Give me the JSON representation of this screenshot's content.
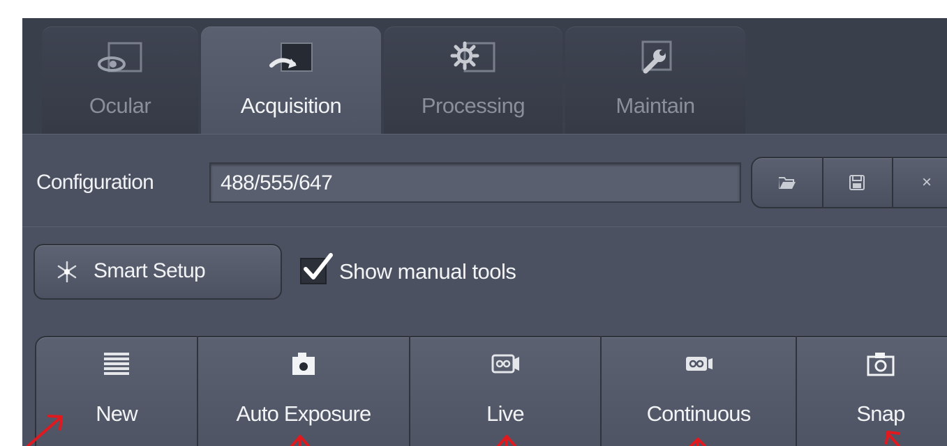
{
  "tabs": [
    {
      "label": "Ocular",
      "icon": "eye-icon"
    },
    {
      "label": "Acquisition",
      "icon": "acquisition-icon"
    },
    {
      "label": "Processing",
      "icon": "gear-icon"
    },
    {
      "label": "Maintain",
      "icon": "wrench-icon"
    }
  ],
  "active_tab": "Acquisition",
  "configuration": {
    "label": "Configuration",
    "value": "488/555/647",
    "buttons": [
      "folder-open-icon",
      "save-icon",
      "close-icon"
    ],
    "close_glyph": "×"
  },
  "setup": {
    "smart_setup_label": "Smart Setup",
    "show_manual_tools_label": "Show manual tools",
    "show_manual_tools_checked": true
  },
  "actions": [
    {
      "label": "New",
      "icon": "list-icon"
    },
    {
      "label": "Auto Exposure",
      "icon": "camera-icon"
    },
    {
      "label": "Live",
      "icon": "video-camera-icon"
    },
    {
      "label": "Continuous",
      "icon": "video-camera-icon"
    },
    {
      "label": "Snap",
      "icon": "camera-icon"
    }
  ],
  "colors": {
    "panel": "#4b5161",
    "tabbar": "#3a3f4c",
    "text": "#f2f3f5",
    "annotation_arrow": "#e0191f"
  }
}
